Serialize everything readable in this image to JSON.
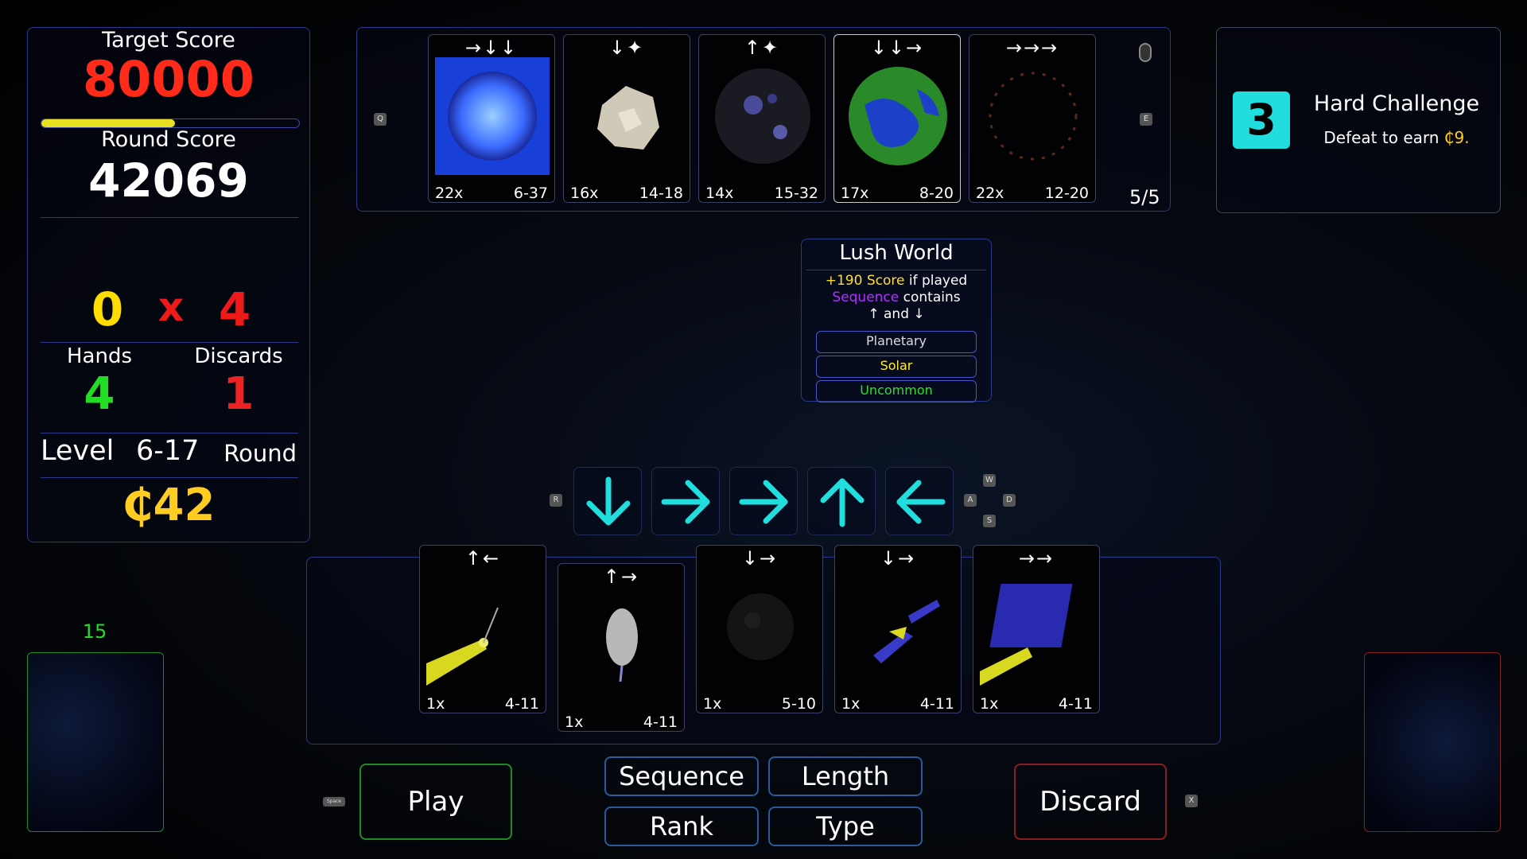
{
  "stats": {
    "target_label": "Target Score",
    "target_value": "80000",
    "target_progress": 0.52,
    "round_label": "Round Score",
    "round_value": "42069",
    "mult_left": "0",
    "mult_sign": "x",
    "mult_right": "4",
    "hands_label": "Hands",
    "hands_value": "4",
    "discards_label": "Discards",
    "discards_value": "1",
    "level_label": "Level",
    "level_value": "6-17",
    "round_word": "Round",
    "money": "₵42"
  },
  "top_row": {
    "key_left": "Q",
    "key_right": "E",
    "counter": "5/5",
    "cards": [
      {
        "arrows": "→↓↓",
        "mult": "22x",
        "rank": "6-37",
        "art": "blue-star"
      },
      {
        "arrows": "↓✦",
        "mult": "16x",
        "rank": "14-18",
        "art": "asteroid"
      },
      {
        "arrows": "↑✦",
        "mult": "14x",
        "rank": "15-32",
        "art": "dark-planet"
      },
      {
        "arrows": "↓↓→",
        "mult": "17x",
        "rank": "8-20",
        "art": "lush-world"
      },
      {
        "arrows": "→→→",
        "mult": "22x",
        "rank": "12-20",
        "art": "ring"
      }
    ]
  },
  "challenge": {
    "badge": "3",
    "title": "Hard Challenge",
    "subtitle": "Defeat to earn",
    "reward": "₵9."
  },
  "tooltip": {
    "title": "Lush World",
    "bonus": "+190 Score",
    "line1_rest": " if played",
    "keyword": "Sequence",
    "line2_rest": " contains",
    "line3": "↑ and ↓",
    "tags": [
      "Planetary",
      "Solar",
      "Uncommon"
    ]
  },
  "sequence": {
    "key_reset": "R",
    "arrows": [
      "down",
      "right",
      "right",
      "up",
      "left"
    ],
    "keys": {
      "up": "W",
      "left": "A",
      "right": "D",
      "down": "S"
    }
  },
  "hand": {
    "cards": [
      {
        "arrows": "↑←",
        "mult": "1x",
        "rank": "4-11",
        "art": "probe-yellow"
      },
      {
        "arrows": "↑→",
        "mult": "1x",
        "rank": "4-11",
        "art": "capsule"
      },
      {
        "arrows": "↓→",
        "mult": "1x",
        "rank": "5-10",
        "art": "dark-asteroid"
      },
      {
        "arrows": "↓→",
        "mult": "1x",
        "rank": "4-11",
        "art": "satellite"
      },
      {
        "arrows": "→→",
        "mult": "1x",
        "rank": "4-11",
        "art": "solar-array"
      }
    ]
  },
  "deck": {
    "count": "15"
  },
  "buttons": {
    "play": "Play",
    "play_key": "Space",
    "sequence": "Sequence",
    "length": "Length",
    "rank": "Rank",
    "type": "Type",
    "discard": "Discard",
    "discard_key": "X"
  },
  "colors": {
    "target": "#ff2a1a",
    "gold": "#ffcc22",
    "green": "#22dd22",
    "red": "#ee2222",
    "cyan": "#22dddd",
    "purple": "#b030ff",
    "panel_border": "#2a3a8a"
  }
}
